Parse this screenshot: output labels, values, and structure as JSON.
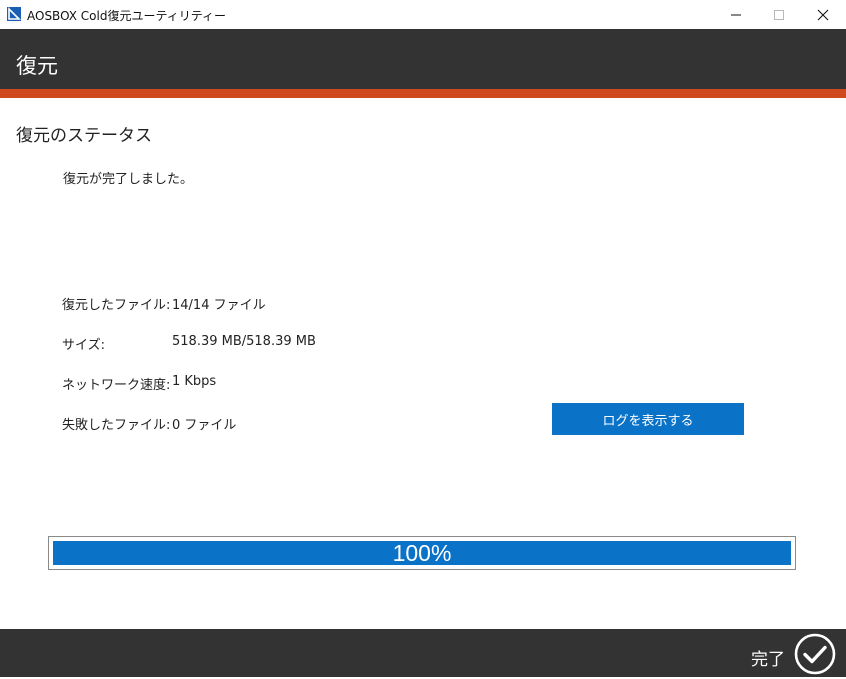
{
  "window": {
    "title": "AOSBOX Cold復元ユーティリティー"
  },
  "header": {
    "title": "復元"
  },
  "colors": {
    "header_bg": "#333333",
    "accent": "#d04a1f",
    "primary_blue": "#0a73c8"
  },
  "main": {
    "section_title": "復元のステータス",
    "status_message": "復元が完了しました。",
    "stats": [
      {
        "label": "復元したファイル:",
        "value": "14/14 ファイル"
      },
      {
        "label": "サイズ:",
        "value": "518.39 MB/518.39 MB"
      },
      {
        "label": "ネットワーク速度:",
        "value": "1 Kbps"
      },
      {
        "label": "失敗したファイル:",
        "value": "0 ファイル"
      }
    ],
    "log_button_label": "ログを表示する"
  },
  "progress": {
    "value": 100,
    "label": "100%"
  },
  "footer": {
    "finish_label": "完了"
  },
  "icons": {
    "app": "app-logo-icon",
    "minimize": "minimize-icon",
    "maximize": "maximize-icon",
    "close": "close-icon",
    "finish": "checkmark-circle-icon"
  }
}
